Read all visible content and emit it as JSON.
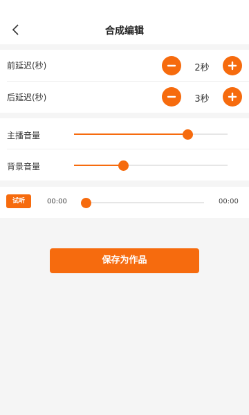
{
  "header": {
    "title": "合成编辑",
    "back_icon": "chevron-left-icon"
  },
  "delays": [
    {
      "label": "前延迟(秒)",
      "value": "2秒"
    },
    {
      "label": "后延迟(秒)",
      "value": "3秒"
    }
  ],
  "volumes": [
    {
      "label": "主播音量",
      "level": 0.74
    },
    {
      "label": "背景音量",
      "level": 0.32
    }
  ],
  "preview": {
    "button_label": "试听",
    "current_time": "00:00",
    "total_time": "00:00",
    "progress": 0.0
  },
  "save_button": {
    "label": "保存为作品"
  },
  "colors": {
    "accent": "#f66b0e",
    "background": "#f5f5f5"
  }
}
